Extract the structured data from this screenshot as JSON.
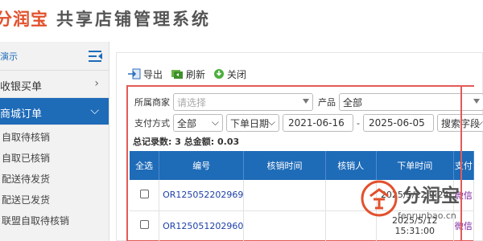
{
  "header": {
    "brand_prefix": "分润宝",
    "brand_suffix": "共享店铺管理系统"
  },
  "sidebar": {
    "demo_label": "演示",
    "items": [
      {
        "label": "收银买单"
      },
      {
        "label": "商城订单"
      }
    ],
    "subitems": [
      {
        "label": "自取待核销"
      },
      {
        "label": "自取已核销"
      },
      {
        "label": "配送待发货"
      },
      {
        "label": "配送已发货"
      },
      {
        "label": "联盟自取待核销"
      }
    ]
  },
  "toolbar": {
    "export": "导出",
    "refresh": "刷新",
    "close": "关闭"
  },
  "filters": {
    "merchant_label": "所属商家",
    "merchant_placeholder": "请选择",
    "product_label": "产品",
    "product_value": "全部",
    "pay_label": "支付方式",
    "pay_value": "全部",
    "date_type": "下单日期",
    "date_from": "2021-06-16",
    "date_sep": "-",
    "date_to": "2025-06-05",
    "search_field": "搜索字段"
  },
  "summary": {
    "count_label": "总记录数:",
    "count_value": "3",
    "amount_label": "总金额:",
    "amount_value": "0.03"
  },
  "table": {
    "headers": [
      "全选",
      "编号",
      "核销时间",
      "核销人",
      "下单时间",
      "支付"
    ],
    "rows": [
      {
        "id": "OR125052202969",
        "verify_time": "",
        "verifier": "",
        "order_time": "2025/5/22 9:24",
        "pay": "微信"
      },
      {
        "id": "OR125051202960",
        "verify_time": "",
        "verifier": "",
        "order_time": "2025/5/12 15:31:00",
        "pay": "微信"
      }
    ]
  },
  "watermark": {
    "name": "分润宝",
    "url": "fenrunbao.cn"
  },
  "colors": {
    "brand": "#e2512d",
    "primary": "#1e6bb8",
    "highlight": "#e25b56"
  }
}
